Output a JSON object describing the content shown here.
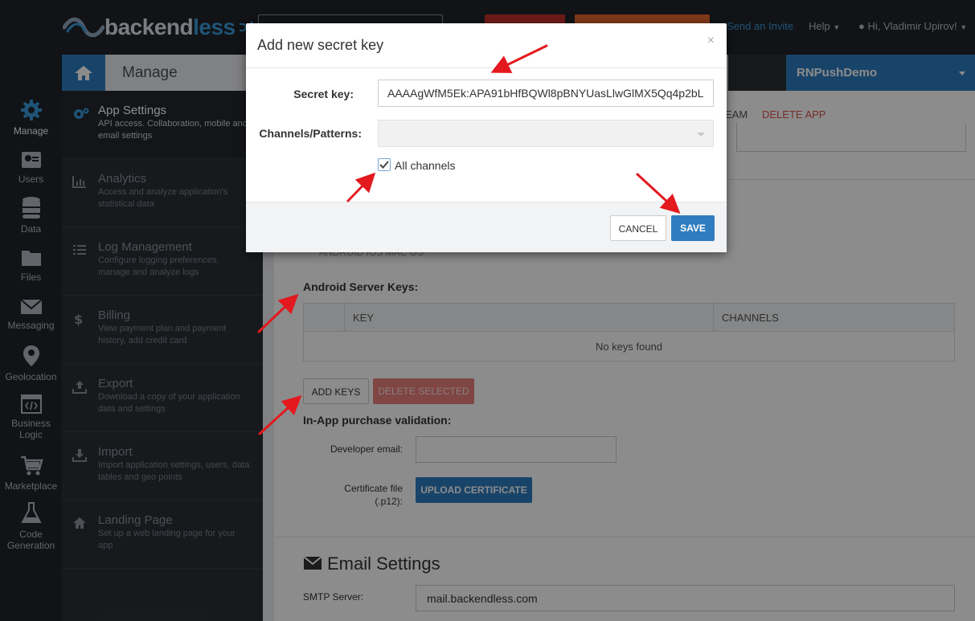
{
  "topbar": {
    "logo_main": "backend",
    "logo_accent": "less",
    "invite": "Send an Invite",
    "help": "Help",
    "user": "Hi, Vladimir Upirov!"
  },
  "rail": [
    {
      "label": "Manage",
      "icon": "gear-icon"
    },
    {
      "label": "Users",
      "icon": "users-icon"
    },
    {
      "label": "Data",
      "icon": "database-icon"
    },
    {
      "label": "Files",
      "icon": "folder-icon"
    },
    {
      "label": "Messaging",
      "icon": "envelope-icon"
    },
    {
      "label": "Geolocation",
      "icon": "map-pin-icon"
    },
    {
      "label": "Business Logic",
      "icon": "code-window-icon"
    },
    {
      "label": "Marketplace",
      "icon": "cart-icon"
    },
    {
      "label": "Code Generation",
      "icon": "flask-icon"
    }
  ],
  "header": {
    "title": "Manage",
    "app_name": "RNPushDemo"
  },
  "menu": [
    {
      "title": "App Settings",
      "desc": "API access. Collaboration, mobile and email settings"
    },
    {
      "title": "Analytics",
      "desc": "Access and analyze application's statistical data"
    },
    {
      "title": "Log Management",
      "desc": "Configure logging preferences, manage and analyze logs"
    },
    {
      "title": "Billing",
      "desc": "View payment plan and payment history, add credit card"
    },
    {
      "title": "Export",
      "desc": "Download a copy of your application data and settings"
    },
    {
      "title": "Import",
      "desc": "Import application settings, users, data tables and geo points"
    },
    {
      "title": "Landing Page",
      "desc": "Set up a web landing page for your app"
    }
  ],
  "content": {
    "tab_team": "EAM",
    "tab_delete": "DELETE APP",
    "platform_tabs": "ANDROID    IOS    MAC OS",
    "keys_label": "Android Server Keys:",
    "col_key": "KEY",
    "col_channels": "CHANNELS",
    "empty": "No keys found",
    "add_keys": "ADD KEYS",
    "delete_selected": "DELETE SELECTED",
    "iap_label": "In-App purchase validation:",
    "dev_email_label": "Developer email:",
    "cert_label_1": "Certificate file",
    "cert_label_2": "(.p12):",
    "upload": "UPLOAD CERTIFICATE",
    "email_title": "Email Settings",
    "smtp_label": "SMTP Server:",
    "smtp_value": "mail.backendless.com"
  },
  "modal": {
    "title": "Add new secret key",
    "close": "×",
    "secret_label": "Secret key:",
    "secret_value": "AAAAgWfM5Ek:APA91bHfBQWl8pBNYUasLlwGlMX5Qq4p2bL",
    "channels_label": "Channels/Patterns:",
    "all_channels": "All channels",
    "all_channels_checked": true,
    "cancel": "CANCEL",
    "save": "SAVE"
  },
  "colors": {
    "accent": "#2f7dc0",
    "danger": "#d9534f",
    "annotation_arrow": "#e3191e"
  }
}
